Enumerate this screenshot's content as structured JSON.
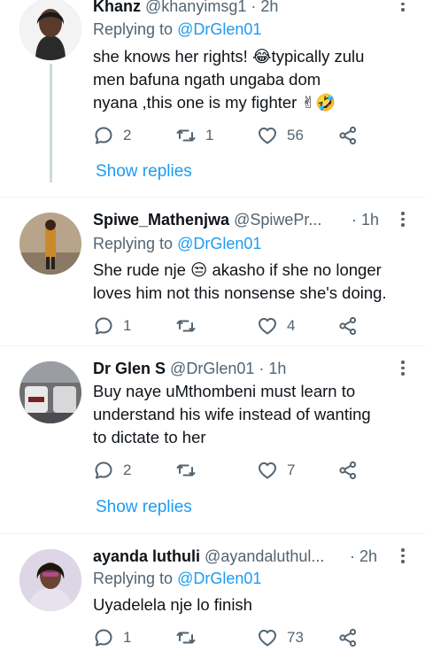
{
  "reply_prefix": "Replying to",
  "show_replies_label": "Show replies",
  "tweets": [
    {
      "name": "Khanz",
      "handle": "@khanyimsg1",
      "time": "· 2h",
      "replying_to": "@DrGlen01",
      "lines": [
        "she knows her rights! 😂typically zulu",
        "men bafuna ngath ungaba dom",
        "nyana ,this one is my fighter ✌🤣"
      ],
      "replies": "2",
      "retweets": "1",
      "likes": "56",
      "show_replies": true
    },
    {
      "name": "Spiwe_Mathenjwa",
      "handle": "@SpiwePr...",
      "time": "· 1h",
      "replying_to": "@DrGlen01",
      "lines": [
        "She rude nje 😒 akasho if she no longer",
        "loves him not this nonsense she's doing."
      ],
      "replies": "1",
      "retweets": "",
      "likes": "4",
      "show_replies": false
    },
    {
      "name": "Dr Glen S",
      "handle": "@DrGlen01",
      "time": "· 1h",
      "replying_to": "",
      "lines": [
        "Buy naye uMthombeni must learn to",
        "understand his wife instead of wanting",
        "to dictate to her"
      ],
      "replies": "2",
      "retweets": "",
      "likes": "7",
      "show_replies": true
    },
    {
      "name": "ayanda luthuli",
      "handle": "@ayandaluthul...",
      "time": "· 2h",
      "replying_to": "@DrGlen01",
      "lines": [
        "Uyadelela nje lo finish"
      ],
      "replies": "1",
      "retweets": "",
      "likes": "73",
      "show_replies": false
    }
  ]
}
